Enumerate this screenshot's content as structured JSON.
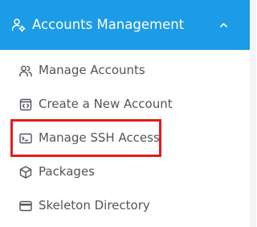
{
  "header": {
    "title": "Accounts Management",
    "icon": "users-cog-icon",
    "collapse_icon": "chevron-up-icon",
    "background_color": "#1c9be6",
    "text_color": "#ffffff"
  },
  "menu": {
    "items": [
      {
        "label": "Manage Accounts",
        "icon": "users-icon"
      },
      {
        "label": "Create a New Account",
        "icon": "user-window-icon"
      },
      {
        "label": "Manage SSH Access",
        "icon": "terminal-icon",
        "highlighted": true
      },
      {
        "label": "Packages",
        "icon": "package-box-icon"
      },
      {
        "label": "Skeleton Directory",
        "icon": "directory-card-icon"
      }
    ],
    "text_color": "#50555b",
    "highlight_color": "#e41c1c"
  }
}
